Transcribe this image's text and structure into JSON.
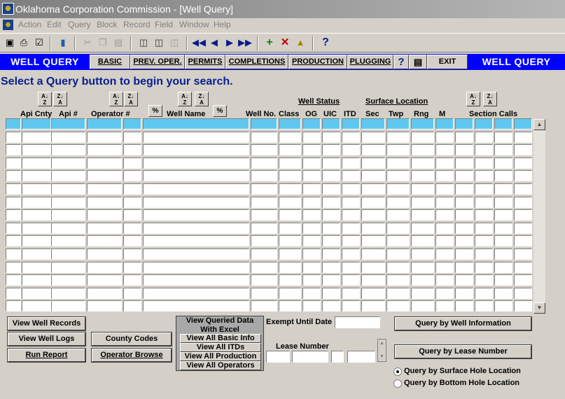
{
  "window": {
    "title": "Oklahoma Corporation Commission - [Well Query]"
  },
  "menu": [
    "Action",
    "Edit",
    "Query",
    "Block",
    "Record",
    "Field",
    "Window",
    "Help"
  ],
  "tabs": {
    "brand_left": "WELL QUERY",
    "brand_right": "WELL QUERY",
    "basic": "BASIC",
    "prev_oper": "PREV. OPER.",
    "permits": "PERMITS",
    "completions": "COMPLETIONS",
    "production": "PRODUCTION",
    "plugging": "PLUGGING",
    "help": "?",
    "exit": "EXIT"
  },
  "prompt": "Select a Query button to begin your search.",
  "headers": {
    "api_cnty": "Api Cnty",
    "api_num": "Api #",
    "operator_num": "Operator #",
    "well_name": "Well Name",
    "well_no": "Well No.",
    "well_status": "Well Status",
    "class": "Class",
    "og": "OG",
    "uic": "UIC",
    "itd": "ITD",
    "surface_location": "Surface Location",
    "sec": "Sec",
    "twp": "Twp",
    "rng": "Rng",
    "m": "M",
    "section_calls": "Section Calls",
    "pct": "%"
  },
  "grid": {
    "rows": 15,
    "selected_row": 0
  },
  "buttons": {
    "view_well_records": "View Well Records",
    "view_well_logs": "View Well Logs",
    "run_report": "Run Report",
    "county_codes": "County Codes",
    "operator_browse": "Operator Browse",
    "query_by_well_info": "Query by Well Information",
    "query_by_lease_number": "Query by Lease Number"
  },
  "excel": {
    "title_line1": "View Queried Data",
    "title_line2": "With Excel",
    "basic": "View All Basic Info",
    "itds": "View All ITDs",
    "production": "View All Production",
    "operators": "View All Operators"
  },
  "fields": {
    "exempt_until_date_label": "Exempt Until Date",
    "exempt_until_date_value": "",
    "lease_number_label": "Lease Number"
  },
  "radios": {
    "surface": "Query by Surface Hole Location",
    "bottom": "Query by Bottom Hole Location",
    "selected": "surface"
  }
}
